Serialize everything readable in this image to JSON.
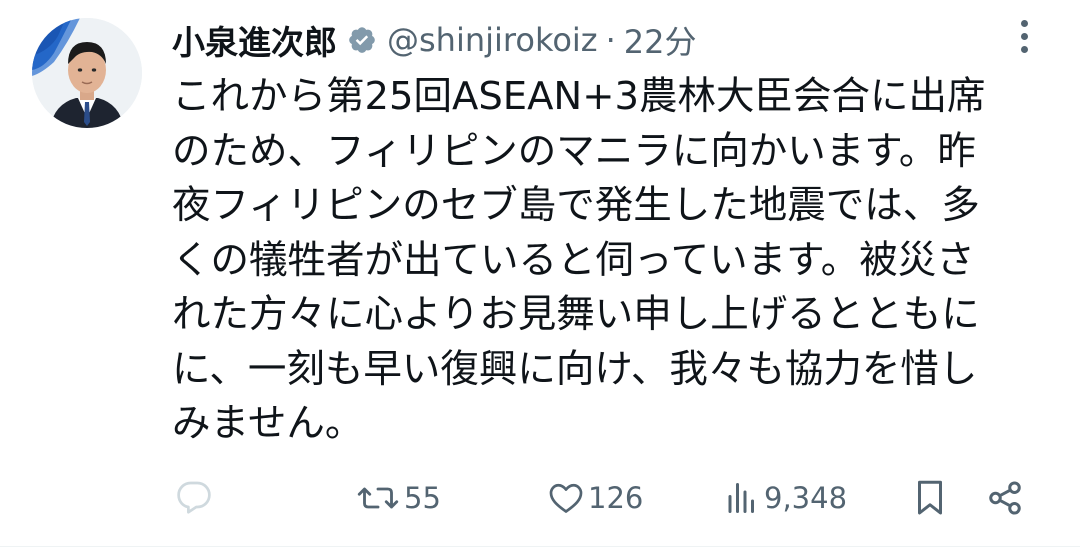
{
  "tweet": {
    "author": {
      "name": "小泉進次郎",
      "handle": "@shinjirokoiz",
      "separator": "·",
      "time": "22分"
    },
    "text": "これから第25回ASEAN+3農林大臣会合に出席\nのため、フィリピンのマニラに向かいます。昨\n夜フィリピンのセブ島で発生した地震では、多\nくの犠牲者が出ていると伺っています。被災さ\nれた方々に心よりお見舞い申し上げるとともに\nに、一刻も早い復興に向け、我々も協力を惜し\nみません。",
    "actions": {
      "reply": {
        "icon": "reply-icon",
        "count": ""
      },
      "retweet": {
        "icon": "retweet-icon",
        "count": "55"
      },
      "like": {
        "icon": "heart-icon",
        "count": "126"
      },
      "views": {
        "icon": "views-icon",
        "count": "9,348"
      },
      "bookmark": {
        "icon": "bookmark-icon"
      },
      "share": {
        "icon": "share-icon"
      }
    }
  },
  "colors": {
    "text": "#0f1419",
    "muted": "#536471",
    "verified_badge": "#829aab",
    "reply_icon": "#cfd9de",
    "avatar_bg": "#1a56b4"
  }
}
